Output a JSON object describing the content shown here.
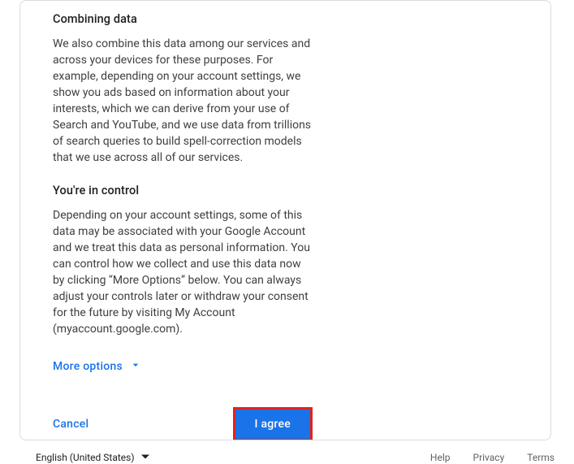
{
  "sections": {
    "combining": {
      "heading": "Combining data",
      "body": "We also combine this data among our services and across your devices for these purposes. For example, depending on your account settings, we show you ads based on information about your interests, which we can derive from your use of Search and YouTube, and we use data from trillions of search queries to build spell-correction models that we use across all of our services."
    },
    "control": {
      "heading": "You're in control",
      "body": "Depending on your account settings, some of this data may be associated with your Google Account and we treat this data as personal information. You can control how we collect and use this data now by clicking “More Options” below. You can always adjust your controls later or withdraw your consent for the future by visiting My Account (myaccount.google.com)."
    }
  },
  "moreOptions": "More options",
  "actions": {
    "cancel": "Cancel",
    "agree": "I agree"
  },
  "footer": {
    "language": "English (United States)",
    "help": "Help",
    "privacy": "Privacy",
    "terms": "Terms"
  }
}
